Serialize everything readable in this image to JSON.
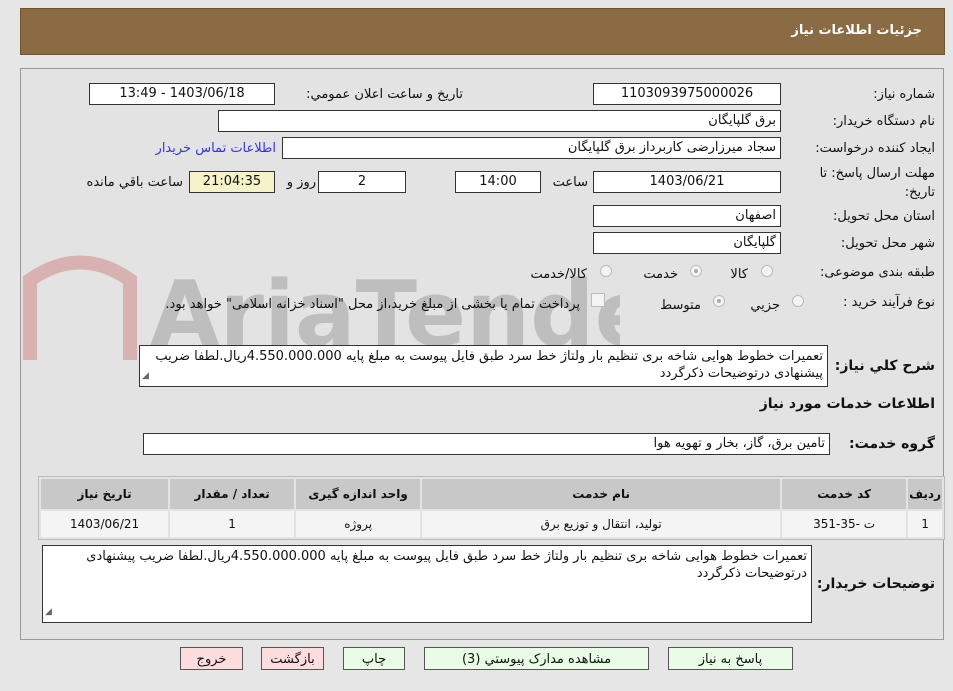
{
  "header": {
    "title": "جزئیات اطلاعات نیاز"
  },
  "form": {
    "need_number_label": "شماره نیاز:",
    "need_number": "1103093975000026",
    "announce_label": "تاریخ و ساعت اعلان عمومي:",
    "announce_value": "1403/06/18 - 13:49",
    "buyer_org_label": "نام دستگاه خریدار:",
    "buyer_org": "برق گلپایگان",
    "creator_label": "ایجاد کننده درخواست:",
    "creator": "سجاد میرزارضی کاربرداز برق گلپایگان",
    "contact_link": "اطلاعات تماس خریدار",
    "deadline_label": "مهلت ارسال پاسخ: تا تاریخ:",
    "deadline_date": "1403/06/21",
    "time_label": "ساعت",
    "deadline_time": "14:00",
    "days": "2",
    "days_label": "روز و",
    "remaining": "21:04:35",
    "remaining_label": "ساعت باقي مانده",
    "province_label": "استان محل تحویل:",
    "province": "اصفهان",
    "city_label": "شهر محل تحویل:",
    "city": "گلپایگان",
    "category_label": "طبقه بندی موضوعی:",
    "category_options": [
      "کالا",
      "خدمت",
      "کالا/خدمت"
    ],
    "category_selected": "خدمت",
    "process_label": "نوع فرآیند خرید :",
    "process_options": [
      "جزيي",
      "متوسط"
    ],
    "process_selected": "متوسط",
    "payment_note": "پرداخت تمام یا بخشی از مبلغ خرید،از محل \"اسناد خزانه اسلامی\" خواهد بود.",
    "summary_label": "شرح کلي نیاز:",
    "summary": "تعمیرات خطوط هوایی شاخه بری تنظیم بار ولتاژ خط سرد  طبق فایل پیوست به مبلغ پایه 4.550.000.000ریال.لطفا ضریب پیشنهادی درتوضیحات ذکرگردد",
    "services_heading": "اطلاعات خدمات مورد نیاز",
    "service_group_label": "گروه خدمت:",
    "service_group": "تامین برق، گاز، بخار و تهویه هوا"
  },
  "table": {
    "headers": [
      "ردیف",
      "کد خدمت",
      "نام خدمت",
      "واحد اندازه گیری",
      "تعداد / مقدار",
      "تاریخ نیاز"
    ],
    "rows": [
      [
        "1",
        "ت -35-351",
        "تولید، انتقال و توزیع برق",
        "پروژه",
        "1",
        "1403/06/21"
      ]
    ]
  },
  "notes": {
    "label": "توضیحات خریدار:",
    "text": "تعمیرات خطوط هوایی شاخه بری تنظیم بار ولتاژ خط سرد  طبق فایل پیوست به مبلغ پایه 4.550.000.000ریال.لطفا ضریب پیشنهادی درتوضیحات ذکرگردد"
  },
  "buttons": {
    "reply": "پاسخ به نیاز",
    "docs": "مشاهده مدارک پیوستي (3)",
    "print": "چاپ",
    "back": "بازگشت",
    "exit": "خروج"
  },
  "watermark": "AriaTender.neT"
}
